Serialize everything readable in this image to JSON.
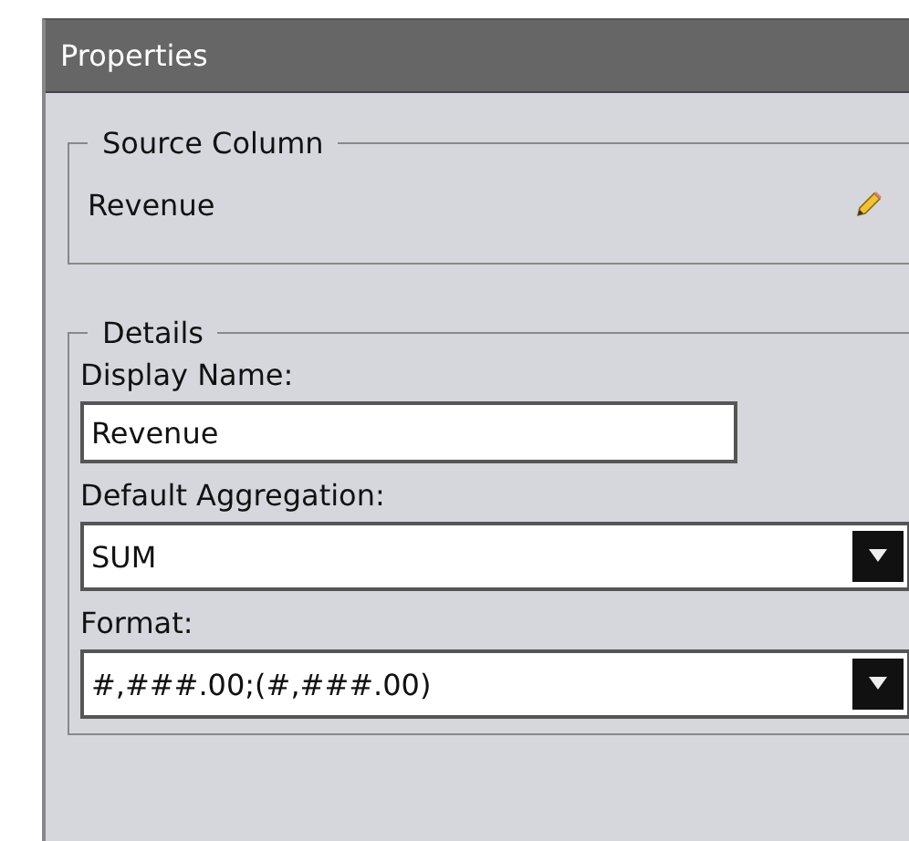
{
  "panel": {
    "title": "Properties"
  },
  "source_column": {
    "legend": "Source Column",
    "value": "Revenue"
  },
  "details": {
    "legend": "Details",
    "fields": [
      {
        "kind": "text",
        "label": "Display Name:",
        "value": "Revenue"
      },
      {
        "kind": "dropdown",
        "label": "Default Aggregation:",
        "value": "SUM"
      },
      {
        "kind": "dropdown",
        "label": "Format:",
        "value": "#,###.00;(#,###.00)"
      }
    ]
  }
}
